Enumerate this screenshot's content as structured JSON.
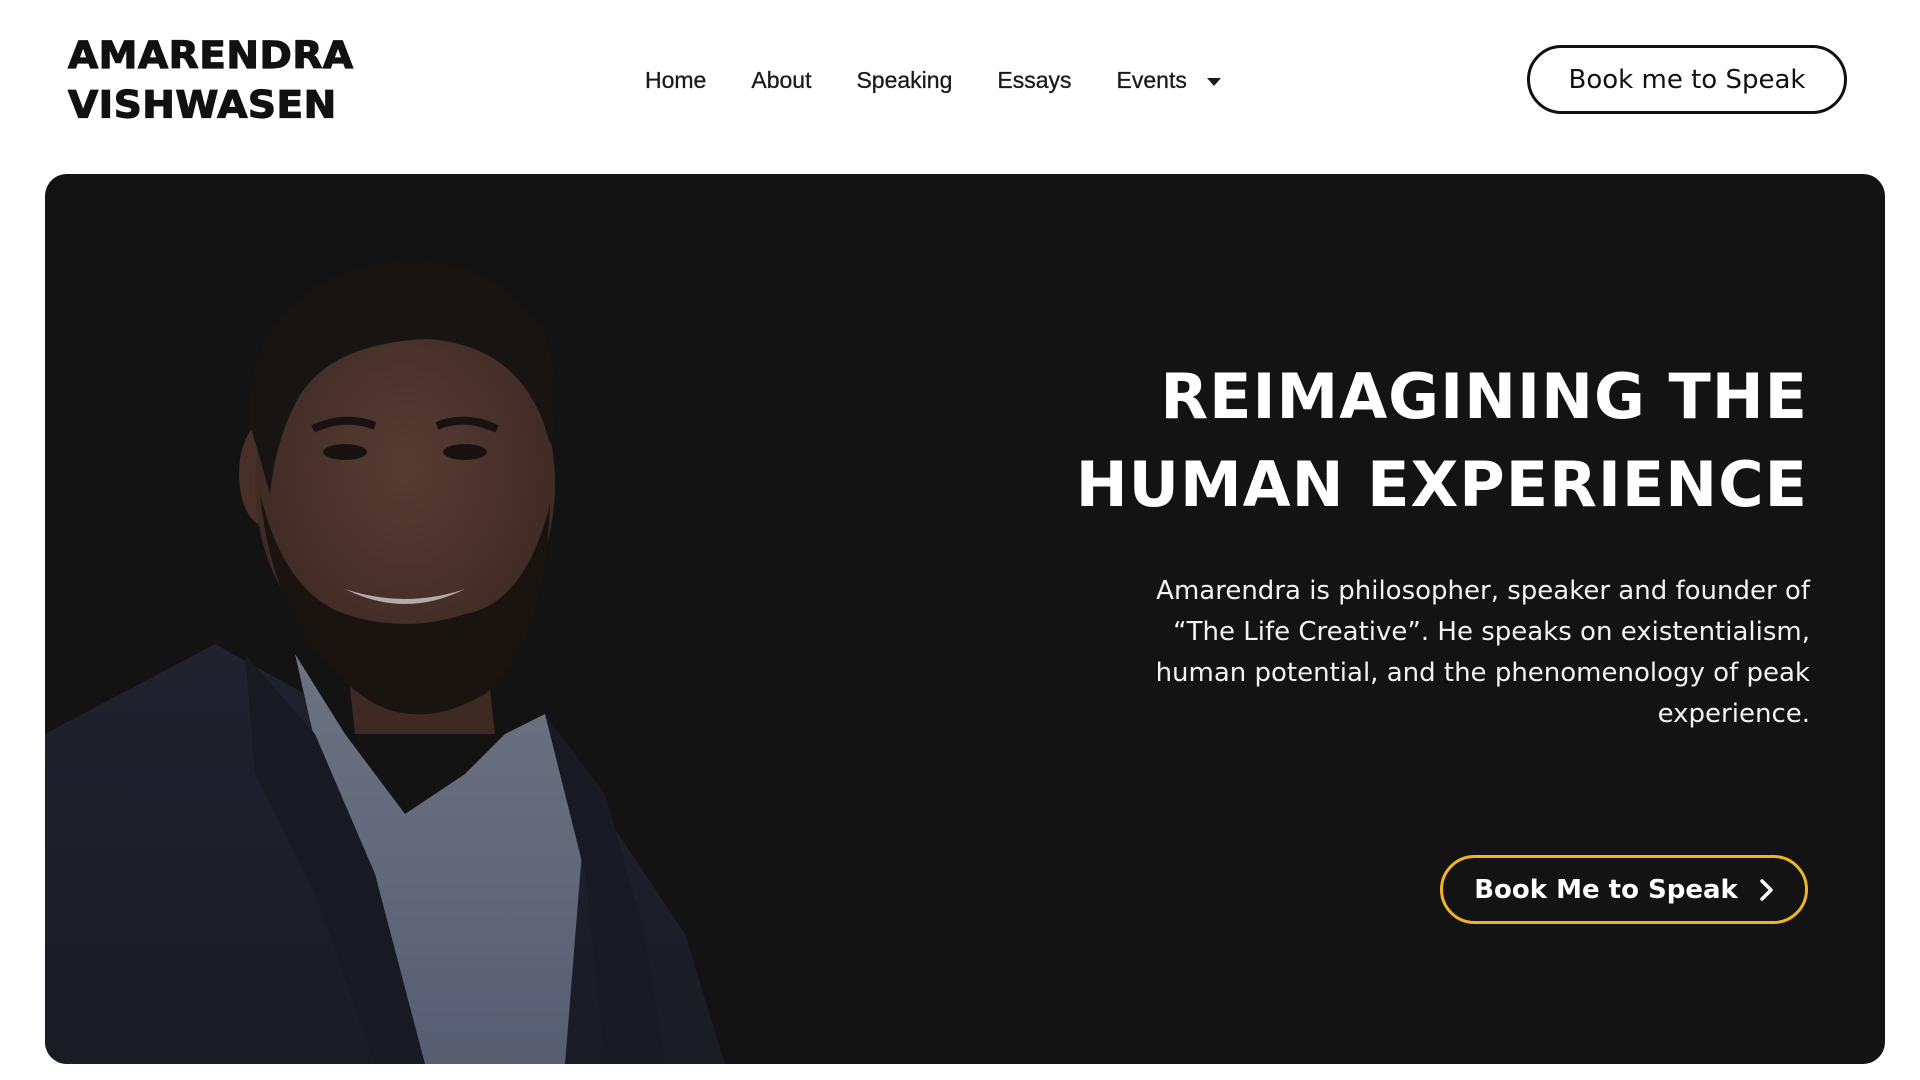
{
  "logo": {
    "line1": "AMARENDRA",
    "line2": "VISHWASEN"
  },
  "nav": {
    "items": [
      {
        "label": "Home"
      },
      {
        "label": "About"
      },
      {
        "label": "Speaking"
      },
      {
        "label": "Essays"
      },
      {
        "label": "Events",
        "has_dropdown": true
      }
    ]
  },
  "header": {
    "cta_label": "Book me to Speak"
  },
  "hero": {
    "title_line1": "REIMAGINING THE",
    "title_line2": "HUMAN EXPERIENCE",
    "description": "Amarendra is philosopher, speaker and founder of “The Life Creative”. He speaks on existentialism, human potential, and the phenomenology of peak experience.",
    "cta_label": "Book Me to Speak",
    "cta_icon": "chevron-right-icon"
  },
  "colors": {
    "hero_background": "#131313",
    "accent_border": "#f0b429",
    "text_dark": "#111111",
    "text_light": "#ffffff"
  }
}
